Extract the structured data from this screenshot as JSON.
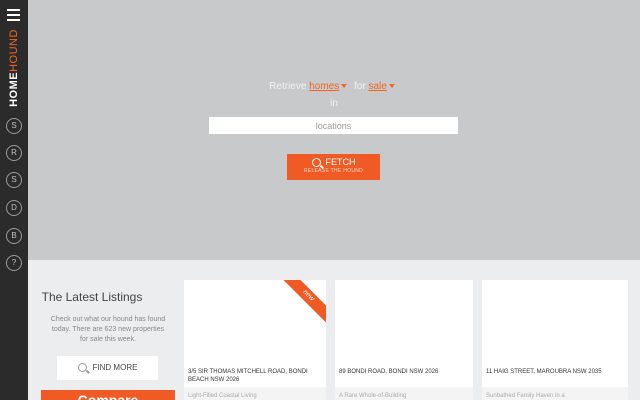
{
  "sidebar": {
    "logo_home": "HOME",
    "logo_hound": "HOUND",
    "buttons": [
      "S",
      "R",
      "S",
      "D",
      "B",
      "?"
    ]
  },
  "search": {
    "retrieve_label": "Retrieve",
    "property_type": "homes",
    "for_label": "for",
    "listing_type": "sale",
    "in_label": "in",
    "location_placeholder": "locations",
    "fetch_label": "FETCH",
    "fetch_sublabel": "RELEASE THE HOUND"
  },
  "latest": {
    "title": "The Latest Listings",
    "description": "Check out what our hound has found today. There are 623 new properties for sale this week.",
    "find_more": "FIND MORE",
    "compare": "Compare"
  },
  "listings": [
    {
      "address": "3/5 SIR THOMAS MITCHELL ROAD, BONDI BEACH NSW 2026",
      "teaser": "Light-Filled Coastal Living",
      "badge": "new"
    },
    {
      "address": "89 BONDI ROAD, BONDI NSW 2026",
      "teaser": "A Rare Whole-of-Building",
      "badge": ""
    },
    {
      "address": "11 HAIG STREET, MAROUBRA NSW 2035",
      "teaser": "Sunbathed Family Haven in a",
      "badge": ""
    }
  ],
  "colors": {
    "accent": "#f05a24",
    "sidebar": "#2b2b2b",
    "hero": "#c8c9ca"
  }
}
